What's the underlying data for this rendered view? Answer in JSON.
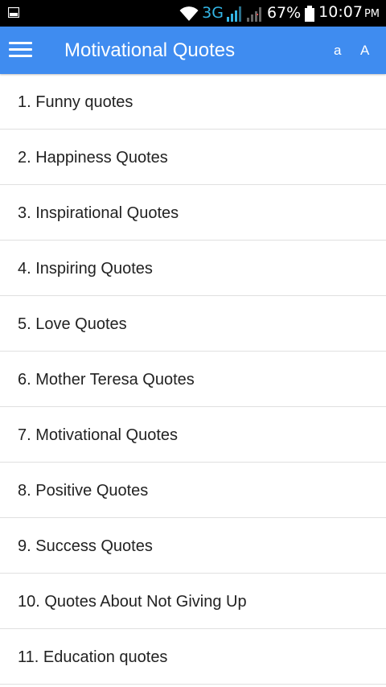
{
  "status_bar": {
    "network": "3G",
    "battery": "67%",
    "time": "10:07",
    "ampm": "PM",
    "icons": [
      "image-icon",
      "wifi-icon",
      "signal-icon",
      "signal-icon",
      "battery-icon"
    ]
  },
  "app_bar": {
    "title": "Motivational Quotes",
    "font_small_label": "a",
    "font_large_label": "A",
    "background": "#3f8cf0"
  },
  "quotes": [
    {
      "label": "1. Funny quotes"
    },
    {
      "label": "2. Happiness Quotes"
    },
    {
      "label": "3. Inspirational Quotes"
    },
    {
      "label": "4. Inspiring Quotes"
    },
    {
      "label": "5. Love Quotes"
    },
    {
      "label": "6. Mother Teresa Quotes"
    },
    {
      "label": "7. Motivational Quotes"
    },
    {
      "label": "8. Positive Quotes"
    },
    {
      "label": "9. Success Quotes"
    },
    {
      "label": "10. Quotes About Not Giving Up"
    },
    {
      "label": "11. Education quotes"
    }
  ]
}
